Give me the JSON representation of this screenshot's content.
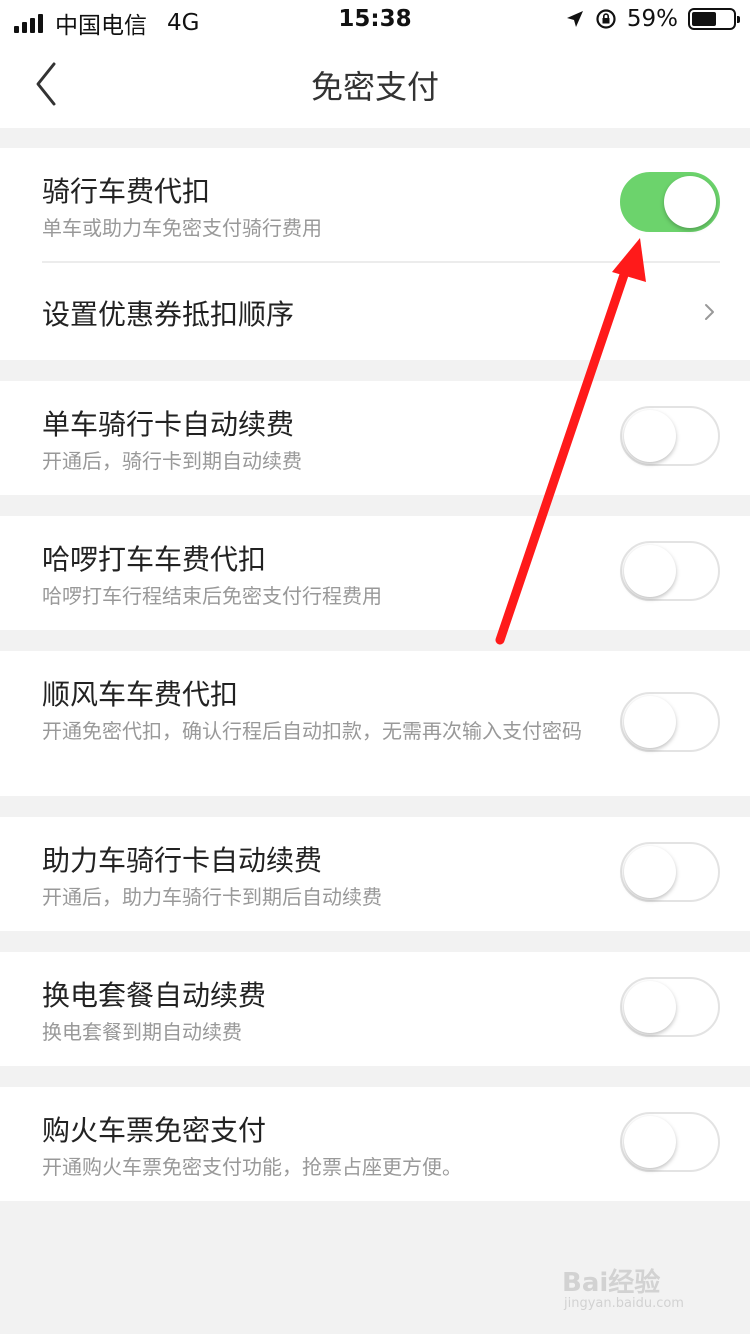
{
  "status_bar": {
    "carrier": "中国电信",
    "network": "4G",
    "time": "15:38",
    "battery": "59%",
    "battery_level": 0.59
  },
  "nav": {
    "title": "免密支付"
  },
  "settings": [
    {
      "title": "骑行车费代扣",
      "subtitle": "单车或助力车免密支付骑行费用",
      "enabled": true
    },
    {
      "title": "设置优惠券抵扣顺序"
    },
    {
      "title": "单车骑行卡自动续费",
      "subtitle": "开通后，骑行卡到期自动续费",
      "enabled": false
    },
    {
      "title": "哈啰打车车费代扣",
      "subtitle": "哈啰打车行程结束后免密支付行程费用",
      "enabled": false
    },
    {
      "title": "顺风车车费代扣",
      "subtitle": "开通免密代扣，确认行程后自动扣款，无需再次输入支付密码",
      "enabled": false
    },
    {
      "title": "助力车骑行卡自动续费",
      "subtitle": "开通后，助力车骑行卡到期后自动续费",
      "enabled": false
    },
    {
      "title": "换电套餐自动续费",
      "subtitle": "换电套餐到期自动续费",
      "enabled": false
    },
    {
      "title": "购火车票免密支付",
      "subtitle": "开通购火车票免密支付功能，抢票占座更方便。",
      "enabled": false
    }
  ],
  "watermark": {
    "text": "Bai经验",
    "sub": "jingyan.baidu.com"
  },
  "colors": {
    "toggle_on": "#6cd36c",
    "annotation_arrow": "#ff1a1a"
  }
}
